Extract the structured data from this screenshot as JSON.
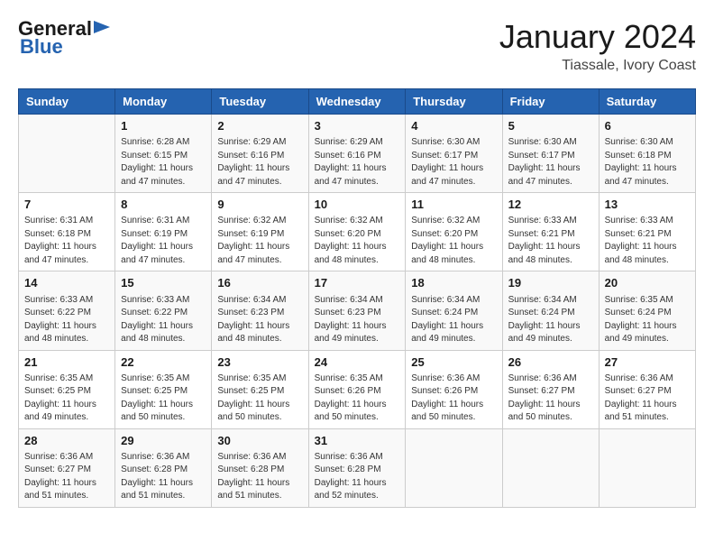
{
  "header": {
    "logo_line1": "General",
    "logo_line2": "Blue",
    "month_year": "January 2024",
    "location": "Tiassale, Ivory Coast"
  },
  "days_of_week": [
    "Sunday",
    "Monday",
    "Tuesday",
    "Wednesday",
    "Thursday",
    "Friday",
    "Saturday"
  ],
  "weeks": [
    [
      {
        "day": "",
        "info": ""
      },
      {
        "day": "1",
        "info": "Sunrise: 6:28 AM\nSunset: 6:15 PM\nDaylight: 11 hours\nand 47 minutes."
      },
      {
        "day": "2",
        "info": "Sunrise: 6:29 AM\nSunset: 6:16 PM\nDaylight: 11 hours\nand 47 minutes."
      },
      {
        "day": "3",
        "info": "Sunrise: 6:29 AM\nSunset: 6:16 PM\nDaylight: 11 hours\nand 47 minutes."
      },
      {
        "day": "4",
        "info": "Sunrise: 6:30 AM\nSunset: 6:17 PM\nDaylight: 11 hours\nand 47 minutes."
      },
      {
        "day": "5",
        "info": "Sunrise: 6:30 AM\nSunset: 6:17 PM\nDaylight: 11 hours\nand 47 minutes."
      },
      {
        "day": "6",
        "info": "Sunrise: 6:30 AM\nSunset: 6:18 PM\nDaylight: 11 hours\nand 47 minutes."
      }
    ],
    [
      {
        "day": "7",
        "info": "Sunrise: 6:31 AM\nSunset: 6:18 PM\nDaylight: 11 hours\nand 47 minutes."
      },
      {
        "day": "8",
        "info": "Sunrise: 6:31 AM\nSunset: 6:19 PM\nDaylight: 11 hours\nand 47 minutes."
      },
      {
        "day": "9",
        "info": "Sunrise: 6:32 AM\nSunset: 6:19 PM\nDaylight: 11 hours\nand 47 minutes."
      },
      {
        "day": "10",
        "info": "Sunrise: 6:32 AM\nSunset: 6:20 PM\nDaylight: 11 hours\nand 48 minutes."
      },
      {
        "day": "11",
        "info": "Sunrise: 6:32 AM\nSunset: 6:20 PM\nDaylight: 11 hours\nand 48 minutes."
      },
      {
        "day": "12",
        "info": "Sunrise: 6:33 AM\nSunset: 6:21 PM\nDaylight: 11 hours\nand 48 minutes."
      },
      {
        "day": "13",
        "info": "Sunrise: 6:33 AM\nSunset: 6:21 PM\nDaylight: 11 hours\nand 48 minutes."
      }
    ],
    [
      {
        "day": "14",
        "info": "Sunrise: 6:33 AM\nSunset: 6:22 PM\nDaylight: 11 hours\nand 48 minutes."
      },
      {
        "day": "15",
        "info": "Sunrise: 6:33 AM\nSunset: 6:22 PM\nDaylight: 11 hours\nand 48 minutes."
      },
      {
        "day": "16",
        "info": "Sunrise: 6:34 AM\nSunset: 6:23 PM\nDaylight: 11 hours\nand 48 minutes."
      },
      {
        "day": "17",
        "info": "Sunrise: 6:34 AM\nSunset: 6:23 PM\nDaylight: 11 hours\nand 49 minutes."
      },
      {
        "day": "18",
        "info": "Sunrise: 6:34 AM\nSunset: 6:24 PM\nDaylight: 11 hours\nand 49 minutes."
      },
      {
        "day": "19",
        "info": "Sunrise: 6:34 AM\nSunset: 6:24 PM\nDaylight: 11 hours\nand 49 minutes."
      },
      {
        "day": "20",
        "info": "Sunrise: 6:35 AM\nSunset: 6:24 PM\nDaylight: 11 hours\nand 49 minutes."
      }
    ],
    [
      {
        "day": "21",
        "info": "Sunrise: 6:35 AM\nSunset: 6:25 PM\nDaylight: 11 hours\nand 49 minutes."
      },
      {
        "day": "22",
        "info": "Sunrise: 6:35 AM\nSunset: 6:25 PM\nDaylight: 11 hours\nand 50 minutes."
      },
      {
        "day": "23",
        "info": "Sunrise: 6:35 AM\nSunset: 6:25 PM\nDaylight: 11 hours\nand 50 minutes."
      },
      {
        "day": "24",
        "info": "Sunrise: 6:35 AM\nSunset: 6:26 PM\nDaylight: 11 hours\nand 50 minutes."
      },
      {
        "day": "25",
        "info": "Sunrise: 6:36 AM\nSunset: 6:26 PM\nDaylight: 11 hours\nand 50 minutes."
      },
      {
        "day": "26",
        "info": "Sunrise: 6:36 AM\nSunset: 6:27 PM\nDaylight: 11 hours\nand 50 minutes."
      },
      {
        "day": "27",
        "info": "Sunrise: 6:36 AM\nSunset: 6:27 PM\nDaylight: 11 hours\nand 51 minutes."
      }
    ],
    [
      {
        "day": "28",
        "info": "Sunrise: 6:36 AM\nSunset: 6:27 PM\nDaylight: 11 hours\nand 51 minutes."
      },
      {
        "day": "29",
        "info": "Sunrise: 6:36 AM\nSunset: 6:28 PM\nDaylight: 11 hours\nand 51 minutes."
      },
      {
        "day": "30",
        "info": "Sunrise: 6:36 AM\nSunset: 6:28 PM\nDaylight: 11 hours\nand 51 minutes."
      },
      {
        "day": "31",
        "info": "Sunrise: 6:36 AM\nSunset: 6:28 PM\nDaylight: 11 hours\nand 52 minutes."
      },
      {
        "day": "",
        "info": ""
      },
      {
        "day": "",
        "info": ""
      },
      {
        "day": "",
        "info": ""
      }
    ]
  ]
}
